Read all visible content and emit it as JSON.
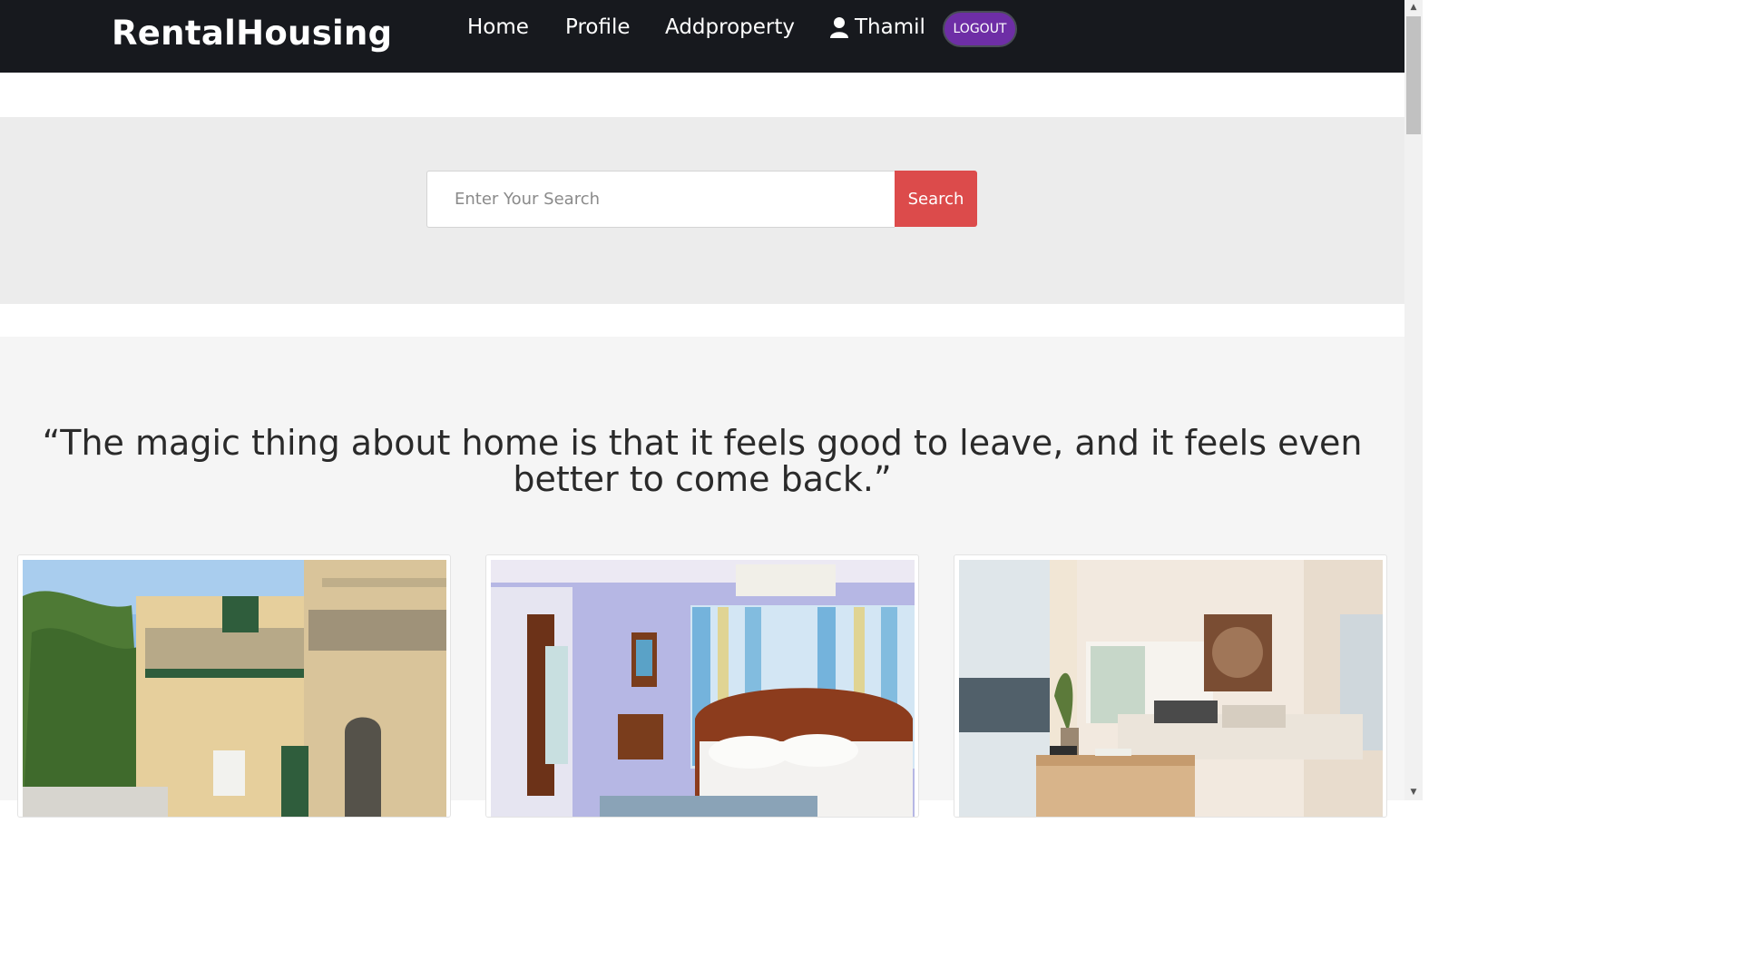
{
  "brand": "RentalHousing",
  "nav": {
    "home": "Home",
    "profile": "Profile",
    "add_property": "Addproperty",
    "user_name": "Thamil",
    "logout": "LOGOUT"
  },
  "search": {
    "placeholder": "Enter Your Search",
    "value": "",
    "button": "Search"
  },
  "quote": "“The magic thing about home is that it feels good to leave, and it feels even better to come back.”",
  "cards": [
    {
      "image": "townhouse-exterior-photo"
    },
    {
      "image": "bedroom-interior-photo"
    },
    {
      "image": "living-room-interior-photo"
    }
  ],
  "colors": {
    "navbar": "#17191e",
    "logout_button": "#6e2ea6",
    "search_button": "#dc4b4b",
    "search_band": "#ececec",
    "content_bg": "#f5f5f5"
  }
}
